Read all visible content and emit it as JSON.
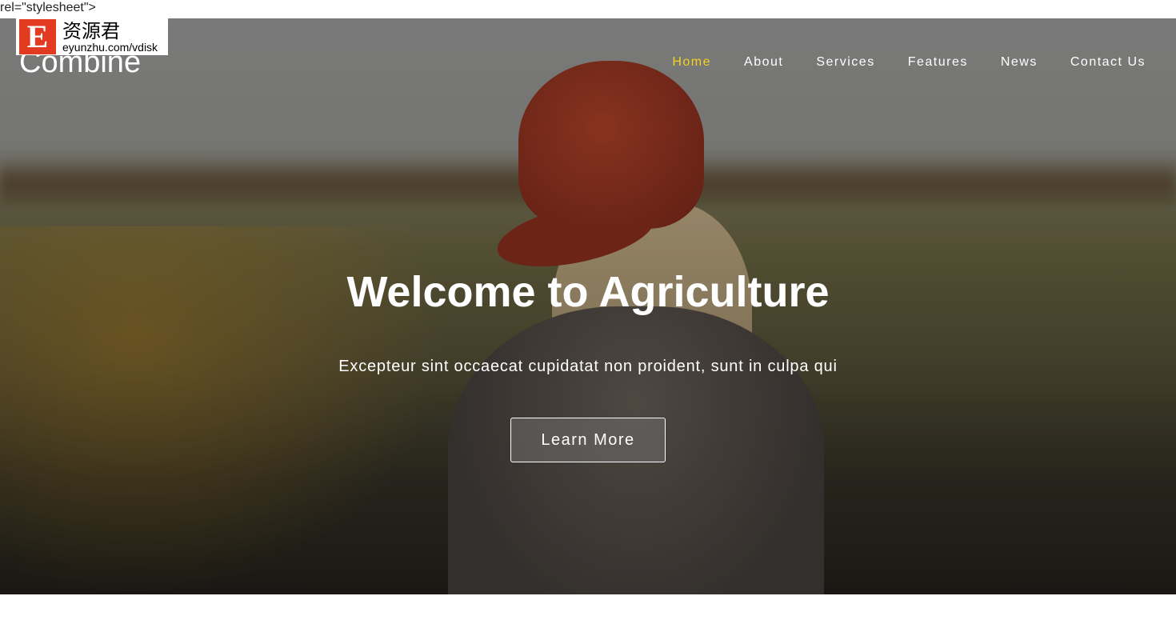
{
  "stray_text": "rel=\"stylesheet\">",
  "watermark": {
    "letter": "E",
    "chinese": "资源君",
    "url": "eyunzhu.com/vdisk"
  },
  "brand": "Combine",
  "nav": [
    {
      "label": "Home",
      "active": true
    },
    {
      "label": "About"
    },
    {
      "label": "Services"
    },
    {
      "label": "Features"
    },
    {
      "label": "News"
    },
    {
      "label": "Contact Us"
    }
  ],
  "hero": {
    "title": "Welcome to Agriculture",
    "subtitle": "Excepteur sint occaecat cupidatat non proident, sunt in culpa qui",
    "button": "Learn More"
  },
  "colors": {
    "active_nav": "#f5d21f"
  }
}
